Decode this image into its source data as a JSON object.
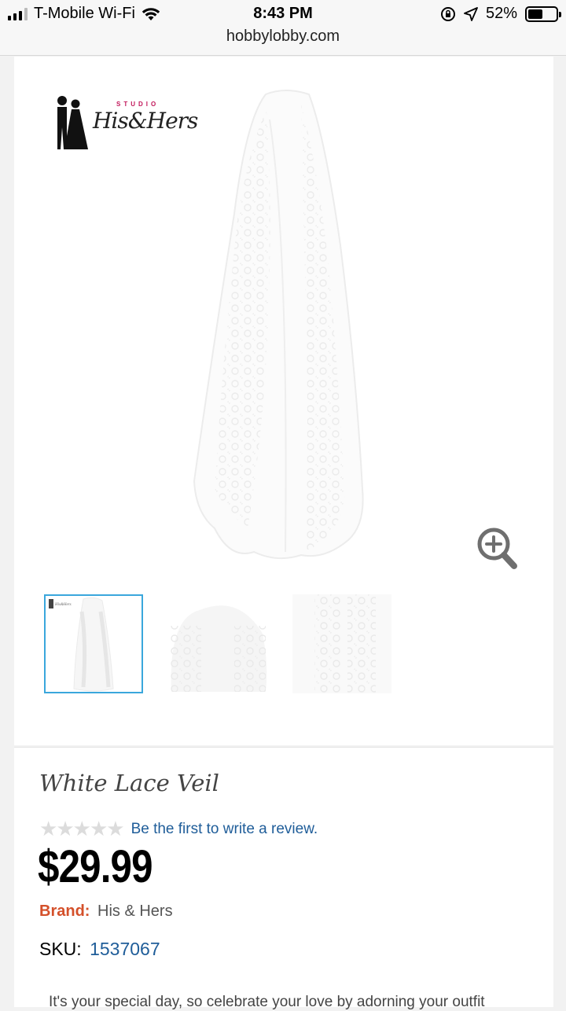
{
  "status_bar": {
    "carrier": "T-Mobile Wi-Fi",
    "time": "8:43 PM",
    "url": "hobbylobby.com",
    "battery": "52%",
    "battery_level": 0.52
  },
  "icons": [
    "signal-icon",
    "wifi-icon",
    "orientation-lock-icon",
    "location-arrow-icon",
    "battery-icon",
    "zoom-in-icon",
    "star-icon"
  ],
  "gallery": {
    "logo_text": "His&Hers",
    "logo_tagline": "STUDIO",
    "thumbnail_count": 3,
    "selected_thumbnail": 1,
    "accent_color": "#3aa7dc"
  },
  "product": {
    "title": "White Lace Veil",
    "rating": 0,
    "rating_max": 5,
    "review_prompt": "Be the first to write a review.",
    "price": "$29.99",
    "brand_label": "Brand:",
    "brand": "His & Hers",
    "sku_label": "SKU:",
    "sku": "1537067",
    "description": "It's your special day, so celebrate your love by adorning your outfit"
  },
  "colors": {
    "link": "#1f5d99",
    "brand_label": "#d4502a"
  }
}
